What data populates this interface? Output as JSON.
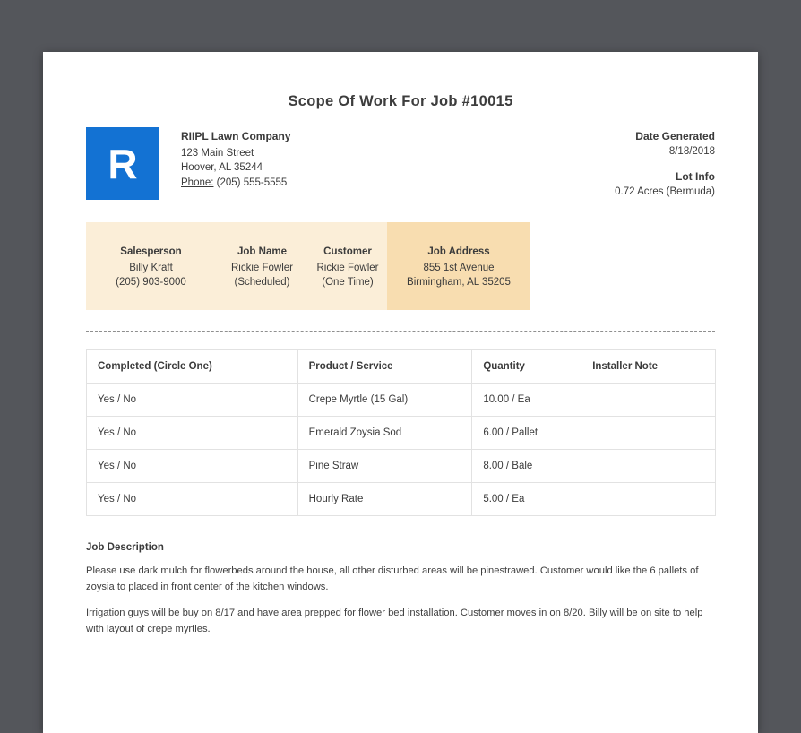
{
  "page": {
    "title": "Scope Of Work For Job #10015"
  },
  "company": {
    "logo_letter": "R",
    "name": "RIIPL Lawn Company",
    "address_line1": "123 Main Street",
    "address_line2": "Hoover, AL 35244",
    "phone_label": "Phone:",
    "phone": "(205) 555-5555"
  },
  "meta": {
    "date_generated_label": "Date Generated",
    "date_generated": "8/18/2018",
    "lot_info_label": "Lot Info",
    "lot_info": "0.72 Acres (Bermuda)"
  },
  "summary": {
    "columns": [
      {
        "label": "Salesperson",
        "line1": "Billy Kraft",
        "line2": "(205) 903-9000"
      },
      {
        "label": "Job Name",
        "line1": "Rickie Fowler",
        "line2": "(Scheduled)"
      },
      {
        "label": "Customer",
        "line1": "Rickie Fowler",
        "line2": "(One Time)"
      },
      {
        "label": "Job Address",
        "line1": "855 1st Avenue",
        "line2": "Birmingham, AL 35205"
      }
    ]
  },
  "work_table": {
    "headers": [
      "Completed (Circle One)",
      "Product / Service",
      "Quantity",
      "Installer Note"
    ],
    "rows": [
      {
        "completed": "Yes / No",
        "product": "Crepe Myrtle (15 Gal)",
        "quantity": "10.00 / Ea",
        "note": ""
      },
      {
        "completed": "Yes / No",
        "product": "Emerald Zoysia Sod",
        "quantity": "6.00 / Pallet",
        "note": ""
      },
      {
        "completed": "Yes / No",
        "product": "Pine Straw",
        "quantity": "8.00 / Bale",
        "note": ""
      },
      {
        "completed": "Yes / No",
        "product": "Hourly Rate",
        "quantity": "5.00 / Ea",
        "note": ""
      }
    ]
  },
  "job_description": {
    "heading": "Job Description",
    "paragraphs": [
      "Please use dark mulch for flowerbeds around the house, all other disturbed areas will be pinestrawed. Customer would like the 6 pallets of zoysia to placed in front center of the kitchen windows.",
      "Irrigation guys will be buy on 8/17 and have area prepped for flower bed installation. Customer moves in on 8/20. Billy will be on site to help with layout of crepe myrtles."
    ]
  },
  "colors": {
    "background": "#54565b",
    "page": "#ffffff",
    "logo_blue": "#1372d3",
    "summary_bg": "#fbeed8",
    "summary_highlight": "#f8ddb0",
    "text": "#3b3b3b"
  }
}
